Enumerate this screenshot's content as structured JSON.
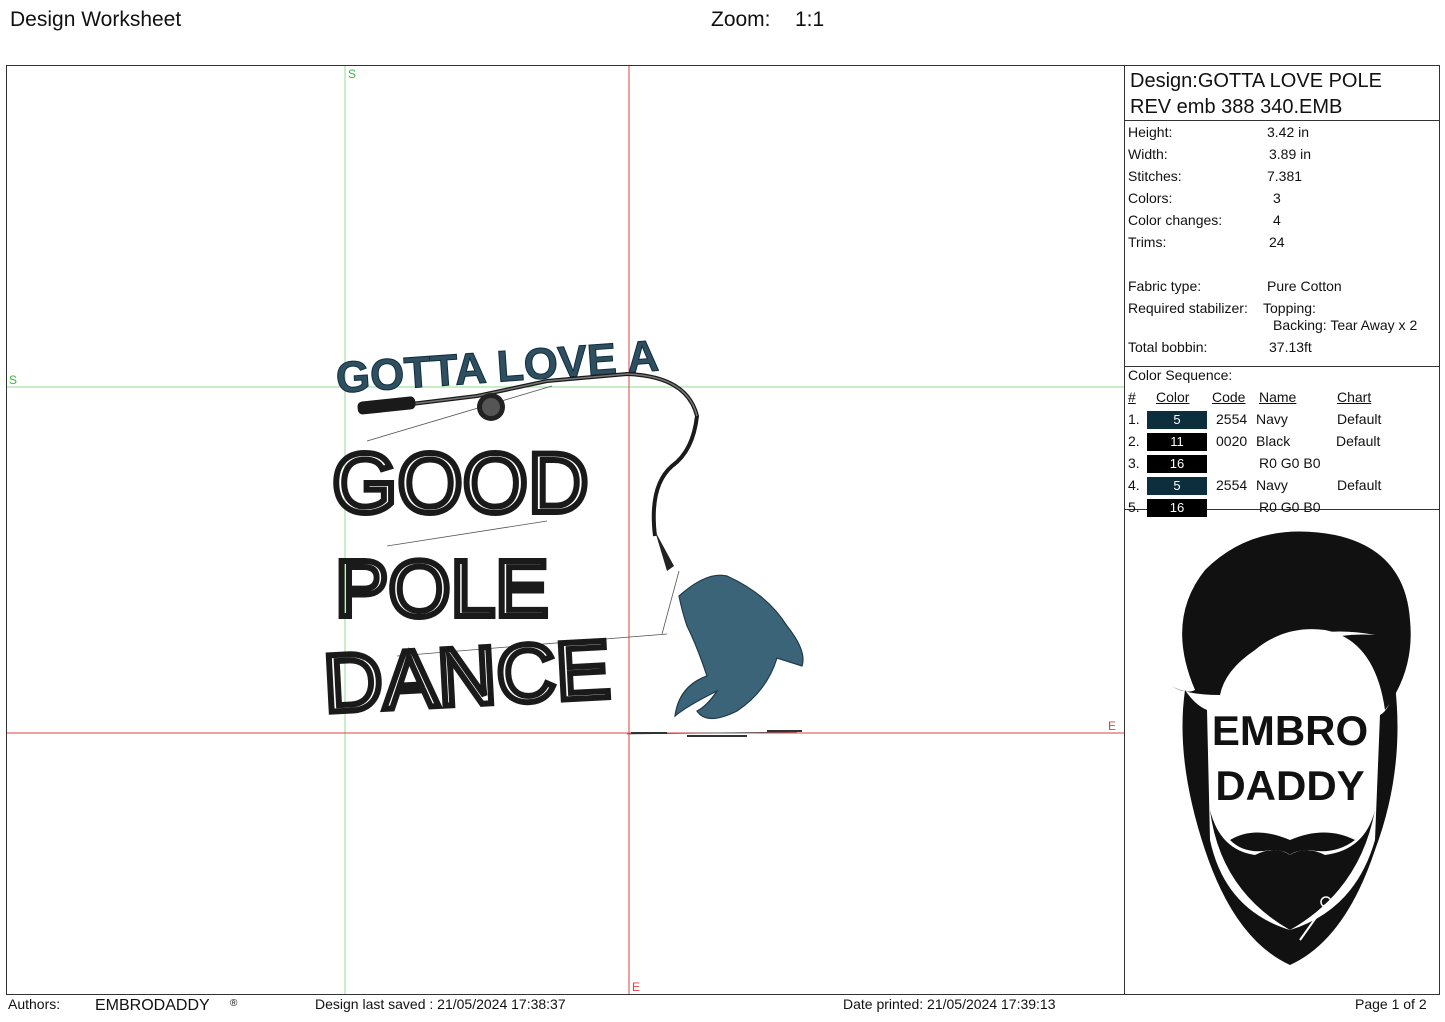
{
  "header": {
    "title": "Design Worksheet",
    "zoom_label": "Zoom:",
    "zoom_value": "1:1"
  },
  "canvas": {
    "marker_start_top": "S",
    "marker_start_left": "S",
    "marker_end_right": "E",
    "marker_end_bottom": "E",
    "design_text": {
      "line1": "GOTTA LOVE A",
      "line2": "GOOD",
      "line3": "POLE",
      "line4": "DANCE"
    }
  },
  "design": {
    "name_line": "Design:GOTTA LOVE POLE",
    "file_line": "REV emb 388 340.EMB",
    "stats": [
      {
        "label": "Height:",
        "value": "3.42 in"
      },
      {
        "label": "Width:",
        "value": "3.89 in"
      },
      {
        "label": "Stitches:",
        "value": "7.381"
      },
      {
        "label": "Colors:",
        "value": "3"
      },
      {
        "label": "Color changes:",
        "value": "4"
      },
      {
        "label": "Trims:",
        "value": "24"
      }
    ],
    "fabric_label": "Fabric type:",
    "fabric_value": "Pure Cotton",
    "stabilizer_label": "Required stabilizer:",
    "topping": "Topping:",
    "backing": "Backing: Tear Away x 2",
    "bobbin_label": "Total bobbin:",
    "bobbin_value": "37.13ft"
  },
  "color_sequence": {
    "title": "Color Sequence:",
    "headers": {
      "num": "#",
      "color": "Color",
      "code": "Code",
      "name": "Name",
      "chart": "Chart"
    },
    "rows": [
      {
        "num": "1.",
        "color": "5",
        "swatch": "#0d2e3d",
        "code": "2554",
        "name": "Navy",
        "chart": "Default"
      },
      {
        "num": "2.",
        "color": "11",
        "swatch": "#000000",
        "code": "0020",
        "name": "Black",
        "chart": "Default"
      },
      {
        "num": "3.",
        "color": "16",
        "swatch": "#000000",
        "code": "",
        "name": "R0 G0 B0",
        "chart": ""
      },
      {
        "num": "4.",
        "color": "5",
        "swatch": "#0d2e3d",
        "code": "2554",
        "name": "Navy",
        "chart": "Default"
      },
      {
        "num": "5.",
        "color": "16",
        "swatch": "#000000",
        "code": "",
        "name": "R0 G0 B0",
        "chart": ""
      }
    ]
  },
  "logo": {
    "line1": "EMBRO",
    "line2": "DADDY",
    "icon": "bearded-man-logo"
  },
  "footer": {
    "authors_label": "Authors:",
    "authors_value": "EMBRODADDY",
    "authors_mark": "®",
    "saved": "Design last saved : 21/05/2024 17:38:37",
    "printed": "Date printed: 21/05/2024 17:39:13",
    "page": "Page 1 of 2"
  },
  "colors": {
    "guide_green": "#7fd97f",
    "guide_red": "#e04040",
    "navy_fill": "#3b6478",
    "black_thread": "#1a1a1a"
  }
}
